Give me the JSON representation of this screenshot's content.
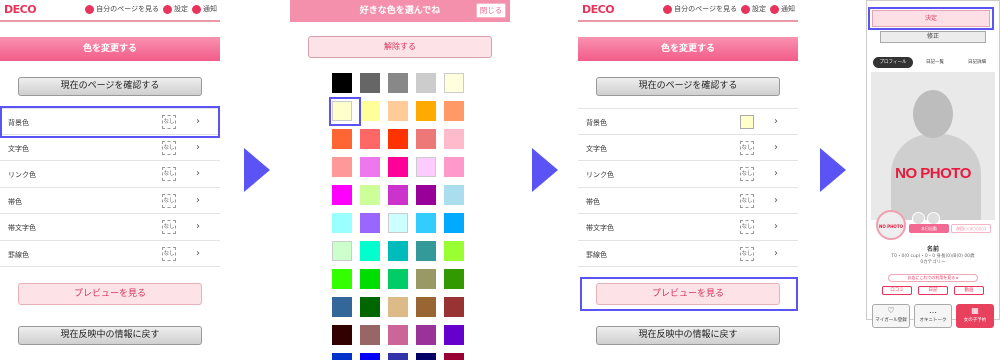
{
  "header": {
    "logo": "DECO",
    "logo_sub": "",
    "my_page": "自分のページを見る",
    "settings": "設定",
    "notifications": "通知"
  },
  "color_page": {
    "title": "色を変更する",
    "check_page": "現在のページを確認する",
    "rows": [
      {
        "label": "背景色",
        "value": "なし"
      },
      {
        "label": "文字色",
        "value": "なし"
      },
      {
        "label": "リンク色",
        "value": "なし"
      },
      {
        "label": "帯色",
        "value": "なし"
      },
      {
        "label": "帯文字色",
        "value": "なし"
      },
      {
        "label": "罫線色",
        "value": "なし"
      }
    ],
    "preview": "プレビューを見る",
    "revert": "現在反映中の情報に戻す"
  },
  "picker": {
    "title": "好きな色を選んでね",
    "close": "閉じる",
    "release": "解除する",
    "colors": [
      [
        "#000000",
        "#666666",
        "#888888",
        "#cccccc",
        "#ffffdd"
      ],
      [
        "#ffffcc",
        "#ffff99",
        "#ffcc99",
        "#ffaa00",
        "#ff9966"
      ],
      [
        "#ff6633",
        "#ff6666",
        "#ff3300",
        "#ee7777",
        "#ffbbcc"
      ],
      [
        "#ff9999",
        "#ee77ee",
        "#ff0099",
        "#ffccff",
        "#ff99cc"
      ],
      [
        "#ff00ff",
        "#ccff99",
        "#cc33cc",
        "#990099",
        "#aaddee"
      ],
      [
        "#99ffff",
        "#9966ff",
        "#ccffff",
        "#33ccff",
        "#00aaff"
      ],
      [
        "#ccffcc",
        "#00ffcc",
        "#00bbbb",
        "#339999",
        "#99ff33"
      ],
      [
        "#33ff00",
        "#00dd00",
        "#00cc66",
        "#999966",
        "#339900"
      ],
      [
        "#336699",
        "#006600",
        "#ddbb88",
        "#996633",
        "#993333"
      ],
      [
        "#330000",
        "#996666",
        "#cc6699",
        "#993399",
        "#6600cc"
      ],
      [
        "#0033cc",
        "#0000ff",
        "#3333aa",
        "#000066",
        "#990033"
      ]
    ],
    "selected": "#ffffcc"
  },
  "color_page_after": {
    "rows": [
      {
        "label": "背景色",
        "value": "",
        "swatch": "#ffffcc"
      },
      {
        "label": "文字色",
        "value": "なし"
      },
      {
        "label": "リンク色",
        "value": "なし"
      },
      {
        "label": "帯色",
        "value": "なし"
      },
      {
        "label": "帯文字色",
        "value": "なし"
      },
      {
        "label": "罫線色",
        "value": "なし"
      }
    ]
  },
  "preview_page": {
    "confirm": "決定",
    "revise": "修正",
    "tabs": [
      "プロフィール",
      "日記一覧",
      "日記詳細"
    ],
    "no_photo": "NO PHOTO",
    "avatar_text": "NO PHOTO",
    "badge1": "本日出勤",
    "badge2": "次回○○/○○(○)",
    "name": "名前",
    "info_line1": "T0・0(0 cup)・0・0 身長(0)/B(0) 00歳",
    "info_line2": "0カテゴリー",
    "pill": "お店にこれでの利用を見る ▸",
    "mini": [
      "口コミ",
      "日記",
      "動画"
    ],
    "actions": [
      {
        "glyph": "♡",
        "label": "マイガール登録"
      },
      {
        "glyph": "…",
        "label": "オキニトーク"
      },
      {
        "glyph": "▦",
        "label": "女の子予約"
      }
    ]
  }
}
